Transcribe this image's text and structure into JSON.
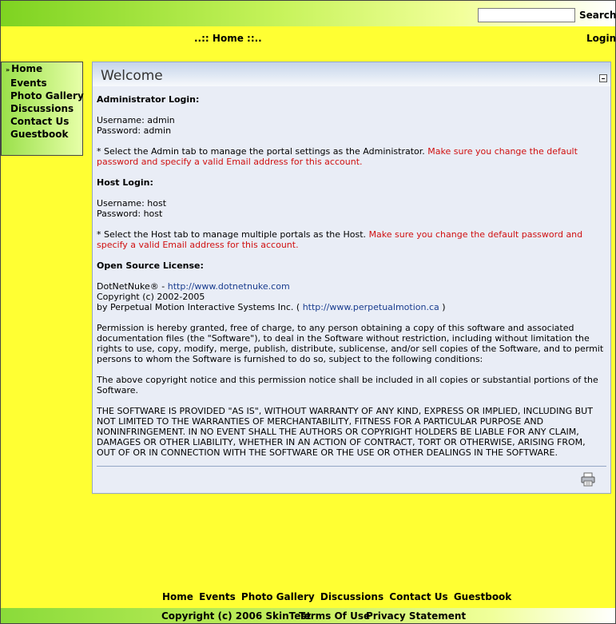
{
  "search": {
    "placeholder": "",
    "button_label": "Search"
  },
  "nav": {
    "prefix": "..:: ",
    "label": "Home",
    "suffix": " ::.."
  },
  "login_label": "Login",
  "side_menu": [
    "Home",
    "Events",
    "Photo Gallery",
    "Discussions",
    "Contact Us",
    "Guestbook"
  ],
  "panel": {
    "title": "Welcome",
    "admin_heading": "Administrator Login:",
    "admin_user": "Username: admin",
    "admin_pass": "Password: admin",
    "admin_note": "* Select the Admin tab to manage the portal settings as the Administrator. ",
    "admin_warning": "Make sure you change the default password and specify a valid Email address for this account.",
    "host_heading": "Host Login:",
    "host_user": "Username: host",
    "host_pass": "Password: host",
    "host_note": "* Select the Host tab to manage multiple portals as the Host. ",
    "host_warning": "Make sure you change the default password and specify a valid Email address for this account.",
    "license_heading": "Open Source License:",
    "dnn_text": "DotNetNuke® - ",
    "dnn_link": "http://www.dotnetnuke.com",
    "copyright": "Copyright (c) 2002-2005",
    "by_text": "by Perpetual Motion Interactive Systems Inc. ( ",
    "pm_link": "http://www.perpetualmotion.ca",
    "by_close": " )",
    "permission": "Permission is hereby granted, free of charge, to any person obtaining a copy of this software and associated documentation files (the \"Software\"), to deal in the Software without restriction, including without limitation the rights to use, copy, modify, merge, publish, distribute, sublicense, and/or sell copies of the Software, and to permit persons to whom the Software is furnished to do so, subject to the following conditions:",
    "notice": "The above copyright notice and this permission notice shall be included in all copies or substantial portions of the Software.",
    "warranty": "THE SOFTWARE IS PROVIDED \"AS IS\", WITHOUT WARRANTY OF ANY KIND, EXPRESS OR IMPLIED, INCLUDING BUT NOT LIMITED TO THE WARRANTIES OF MERCHANTABILITY, FITNESS FOR A PARTICULAR PURPOSE AND NONINFRINGEMENT. IN NO EVENT SHALL THE AUTHORS OR COPYRIGHT HOLDERS BE LIABLE FOR ANY CLAIM, DAMAGES OR OTHER LIABILITY, WHETHER IN AN ACTION OF CONTRACT, TORT OR OTHERWISE, ARISING FROM, OUT OF OR IN CONNECTION WITH THE SOFTWARE OR THE USE OR OTHER DEALINGS IN THE SOFTWARE."
  },
  "footer_menu": [
    "Home",
    "Events",
    "Photo Gallery",
    "Discussions",
    "Contact Us",
    "Guestbook"
  ],
  "footer": {
    "copyright": "Copyright (c) 2006 SkinTest",
    "terms": "Terms Of Use",
    "privacy": "Privacy Statement"
  },
  "colors": {
    "page_bg": "#ffff33",
    "accent_green": "#7ed321",
    "panel_bg": "#e9edf6",
    "warning": "#d01010",
    "link": "#1a3d8f"
  },
  "icons": {
    "print": "printer-icon",
    "minimize": "minimize-icon"
  }
}
